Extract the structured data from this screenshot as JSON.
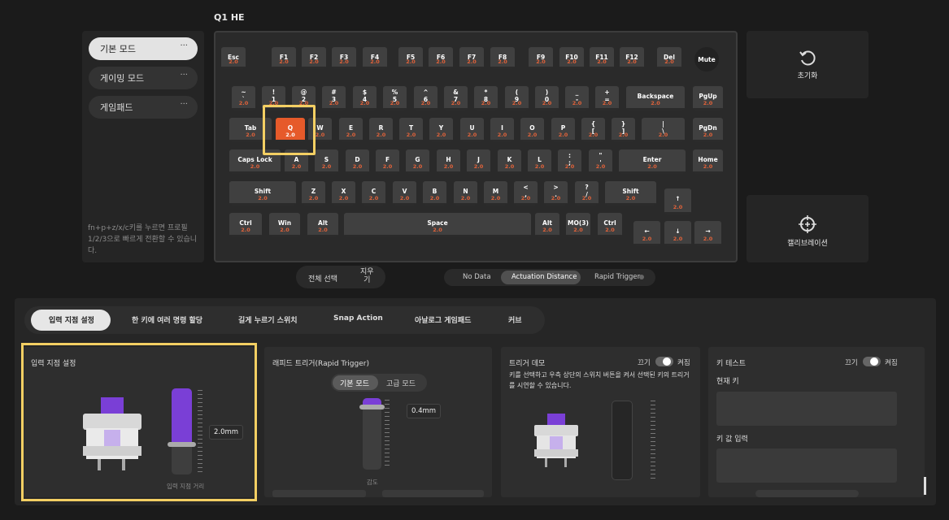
{
  "device_title": "Q1 HE",
  "modes": [
    {
      "label": "기본 모드",
      "more": "···"
    },
    {
      "label": "게이밍 모드",
      "more": "···"
    },
    {
      "label": "게임패드",
      "more": "···"
    }
  ],
  "mode_hint": "fn+p+z/x/c키를 누르면 프로필 1/2/3으로 빠르게 전환할 수 있습니다.",
  "keys": [
    {
      "l": "Esc",
      "v": "2.0"
    },
    {
      "l": "F1",
      "v": "2.0"
    },
    {
      "l": "F2",
      "v": "2.0"
    },
    {
      "l": "F3",
      "v": "2.0"
    },
    {
      "l": "F4",
      "v": "2.0"
    },
    {
      "l": "F5",
      "v": "2.0"
    },
    {
      "l": "F6",
      "v": "2.0"
    },
    {
      "l": "F7",
      "v": "2.0"
    },
    {
      "l": "F8",
      "v": "2.0"
    },
    {
      "l": "F9",
      "v": "2.0"
    },
    {
      "l": "F10",
      "v": "2.0"
    },
    {
      "l": "F11",
      "v": "2.0"
    },
    {
      "l": "F12",
      "v": "2.0"
    },
    {
      "l": "Del",
      "v": "2.0"
    },
    {
      "l": "Mute",
      "v": ""
    },
    {
      "l": "~\n`",
      "v": "2.0"
    },
    {
      "l": "!\n1",
      "v": "2.0"
    },
    {
      "l": "@\n2",
      "v": "2.0"
    },
    {
      "l": "#\n3",
      "v": "2.0"
    },
    {
      "l": "$\n4",
      "v": "2.0"
    },
    {
      "l": "%\n5",
      "v": "2.0"
    },
    {
      "l": "^\n6",
      "v": "2.0"
    },
    {
      "l": "&\n7",
      "v": "2.0"
    },
    {
      "l": "*\n8",
      "v": "2.0"
    },
    {
      "l": "(\n9",
      "v": "2.0"
    },
    {
      "l": ")\n0",
      "v": "2.0"
    },
    {
      "l": "_\n-",
      "v": "2.0"
    },
    {
      "l": "+\n=",
      "v": "2.0"
    },
    {
      "l": "Backspace",
      "v": "2.0"
    },
    {
      "l": "PgUp",
      "v": "2.0"
    },
    {
      "l": "Tab",
      "v": "2.0"
    },
    {
      "l": "Q",
      "v": "2.0"
    },
    {
      "l": "W",
      "v": "2.0"
    },
    {
      "l": "E",
      "v": "2.0"
    },
    {
      "l": "R",
      "v": "2.0"
    },
    {
      "l": "T",
      "v": "2.0"
    },
    {
      "l": "Y",
      "v": "2.0"
    },
    {
      "l": "U",
      "v": "2.0"
    },
    {
      "l": "I",
      "v": "2.0"
    },
    {
      "l": "O",
      "v": "2.0"
    },
    {
      "l": "P",
      "v": "2.0"
    },
    {
      "l": "{\n[",
      "v": "2.0"
    },
    {
      "l": "}\n]",
      "v": "2.0"
    },
    {
      "l": "|\n\\",
      "v": "2.0"
    },
    {
      "l": "PgDn",
      "v": "2.0"
    },
    {
      "l": "Caps Lock",
      "v": "2.0"
    },
    {
      "l": "A",
      "v": "2.0"
    },
    {
      "l": "S",
      "v": "2.0"
    },
    {
      "l": "D",
      "v": "2.0"
    },
    {
      "l": "F",
      "v": "2.0"
    },
    {
      "l": "G",
      "v": "2.0"
    },
    {
      "l": "H",
      "v": "2.0"
    },
    {
      "l": "J",
      "v": "2.0"
    },
    {
      "l": "K",
      "v": "2.0"
    },
    {
      "l": "L",
      "v": "2.0"
    },
    {
      "l": ":\n;",
      "v": "2.0"
    },
    {
      "l": "\"\n'",
      "v": "2.0"
    },
    {
      "l": "Enter",
      "v": "2.0"
    },
    {
      "l": "Home",
      "v": "2.0"
    },
    {
      "l": "Shift",
      "v": "2.0"
    },
    {
      "l": "Z",
      "v": "2.0"
    },
    {
      "l": "X",
      "v": "2.0"
    },
    {
      "l": "C",
      "v": "2.0"
    },
    {
      "l": "V",
      "v": "2.0"
    },
    {
      "l": "B",
      "v": "2.0"
    },
    {
      "l": "N",
      "v": "2.0"
    },
    {
      "l": "M",
      "v": "2.0"
    },
    {
      "l": "<\n,",
      "v": "2.0"
    },
    {
      "l": ">\n.",
      "v": "2.0"
    },
    {
      "l": "?\n/",
      "v": "2.0"
    },
    {
      "l": "Shift",
      "v": "2.0"
    },
    {
      "l": "↑",
      "v": "2.0"
    },
    {
      "l": "Ctrl",
      "v": "2.0"
    },
    {
      "l": "Win",
      "v": "2.0"
    },
    {
      "l": "Alt",
      "v": "2.0"
    },
    {
      "l": "Space",
      "v": "2.0"
    },
    {
      "l": "Alt",
      "v": "2.0"
    },
    {
      "l": "MO(3)",
      "v": "2.0"
    },
    {
      "l": "Ctrl",
      "v": "2.0"
    },
    {
      "l": "←",
      "v": "2.0"
    },
    {
      "l": "↓",
      "v": "2.0"
    },
    {
      "l": "→",
      "v": "2.0"
    }
  ],
  "reset_label": "초기화",
  "calibration_label": "캘리브레이션",
  "select_all_label": "전체 선택",
  "clear_label": "지우\n기",
  "view_modes": [
    "No Data",
    "Actuation Distance",
    "Rapid Trigger"
  ],
  "tabs": [
    "입력 지점 설정",
    "한 키에 여러 명령 할당",
    "길게 누르기 스위치",
    "Snap Action",
    "아날로그 게임패드",
    "커브"
  ],
  "actuation": {
    "title": "입력 지점 설정",
    "value": "2.0mm",
    "caption": "입력 지점 거리",
    "level_mm": 2.0
  },
  "rapid": {
    "title": "래피드 트리거(Rapid Trigger)",
    "mode_basic": "기본 모드",
    "mode_advanced": "고급 모드",
    "value": "0.4mm",
    "caption": "감도",
    "level_mm": 0.4
  },
  "demo": {
    "title": "트리거 데모",
    "off": "끄기",
    "on": "켜짐",
    "desc": "키를 선택하고 우측 상단의 스위치 버튼을 켜서 선택된 키의 트리거를 시연할 수 있습니다."
  },
  "keytest": {
    "title": "키 테스트",
    "off": "끄기",
    "on": "켜짐",
    "current_key": "현재 키",
    "input_value": "키 값 입력"
  },
  "colors": {
    "accent": "#e65a2a",
    "switch_purple": "#7a3fd6",
    "highlight": "#f3cf63"
  }
}
